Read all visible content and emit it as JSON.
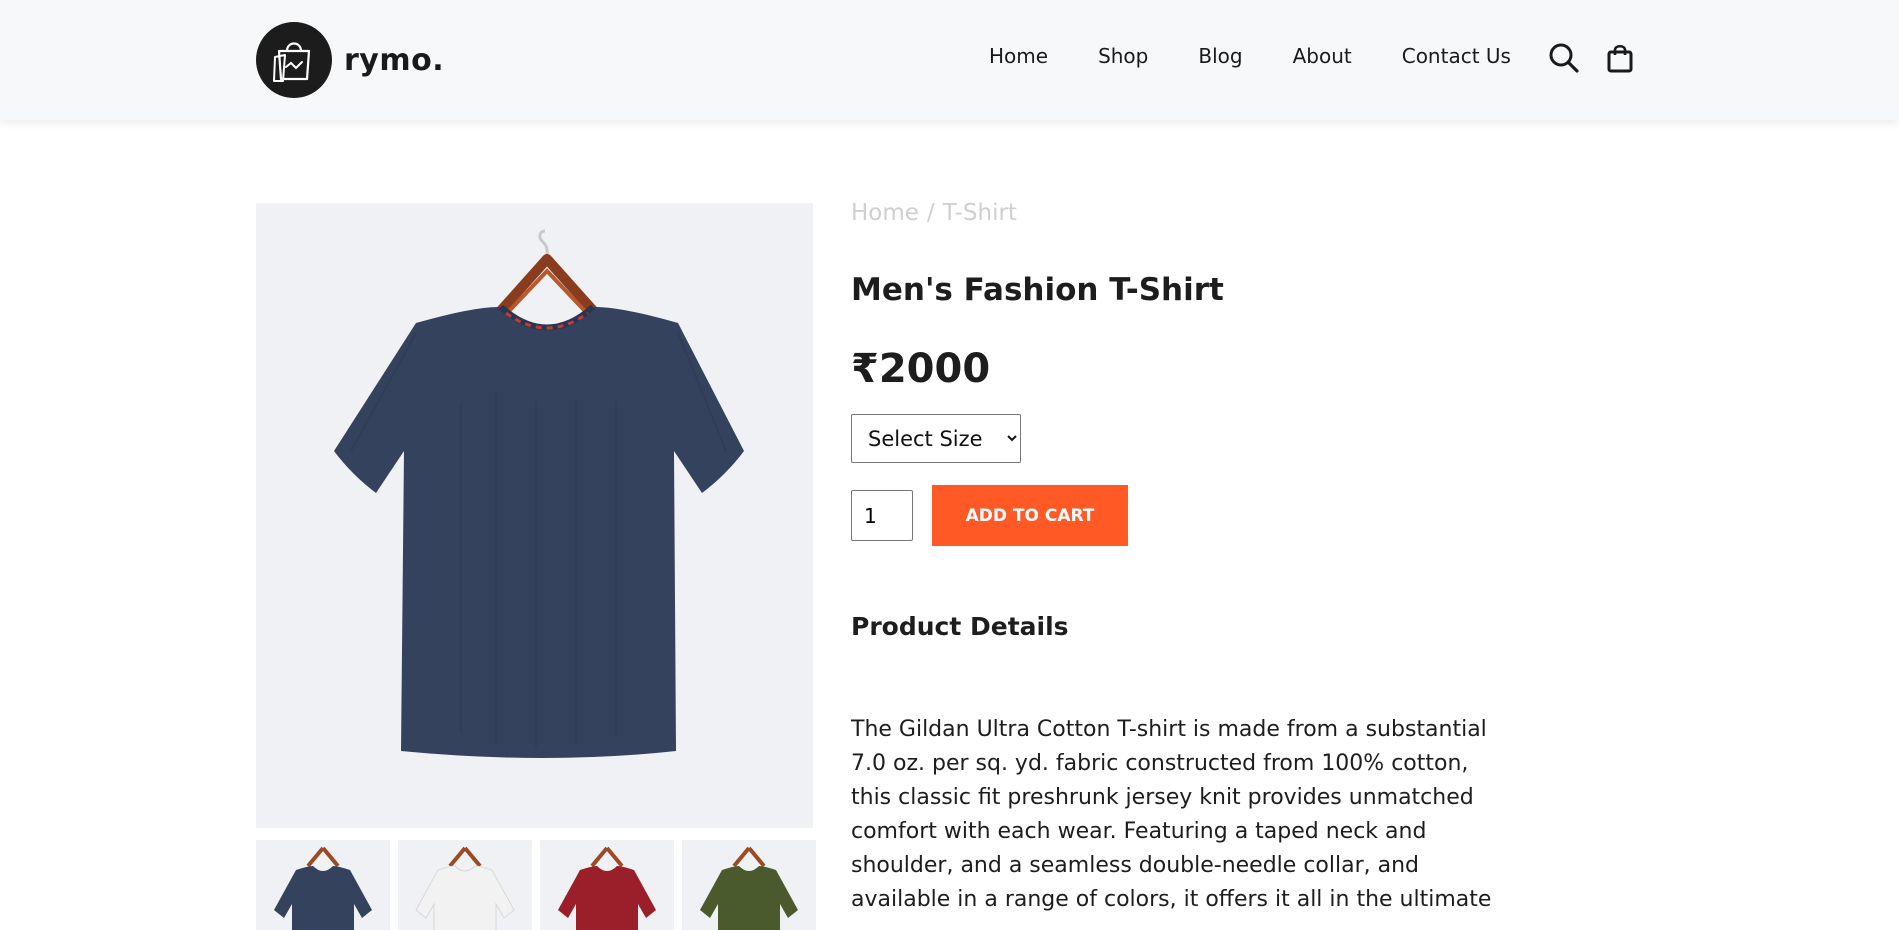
{
  "header": {
    "brand": "rymo.",
    "nav": [
      "Home",
      "Shop",
      "Blog",
      "About",
      "Contact Us"
    ],
    "icons": [
      "search-icon",
      "shopping-bag-icon"
    ]
  },
  "product": {
    "breadcrumb": {
      "home": "Home",
      "separator": "/",
      "category": "T-Shirt"
    },
    "title": "Men's Fashion T-Shirt",
    "price": "₹2000",
    "size_select": {
      "selected": "Select Size",
      "options": [
        "Select Size"
      ]
    },
    "quantity": "1",
    "add_to_cart_label": "ADD TO CART",
    "details_heading": "Product Details",
    "description": "The Gildan Ultra Cotton T-shirt is made from a substantial 7.0 oz. per sq. yd. fabric constructed from 100% cotton, this classic fit preshrunk jersey knit provides unmatched comfort with each wear. Featuring a taped neck and shoulder, and a seamless double-needle collar, and available in a range of colors, it offers it all in the ultimate",
    "thumbnail_colors": [
      "#35425e",
      "#f2f2f2",
      "#9a1f2b",
      "#4a5a2c"
    ]
  },
  "colors": {
    "accent": "#ff5a26",
    "shirt_main": "#35425e",
    "image_bg": "#eff1f4",
    "breadcrumb": "#cfcfcf",
    "header_bg": "#f7f8fa"
  }
}
